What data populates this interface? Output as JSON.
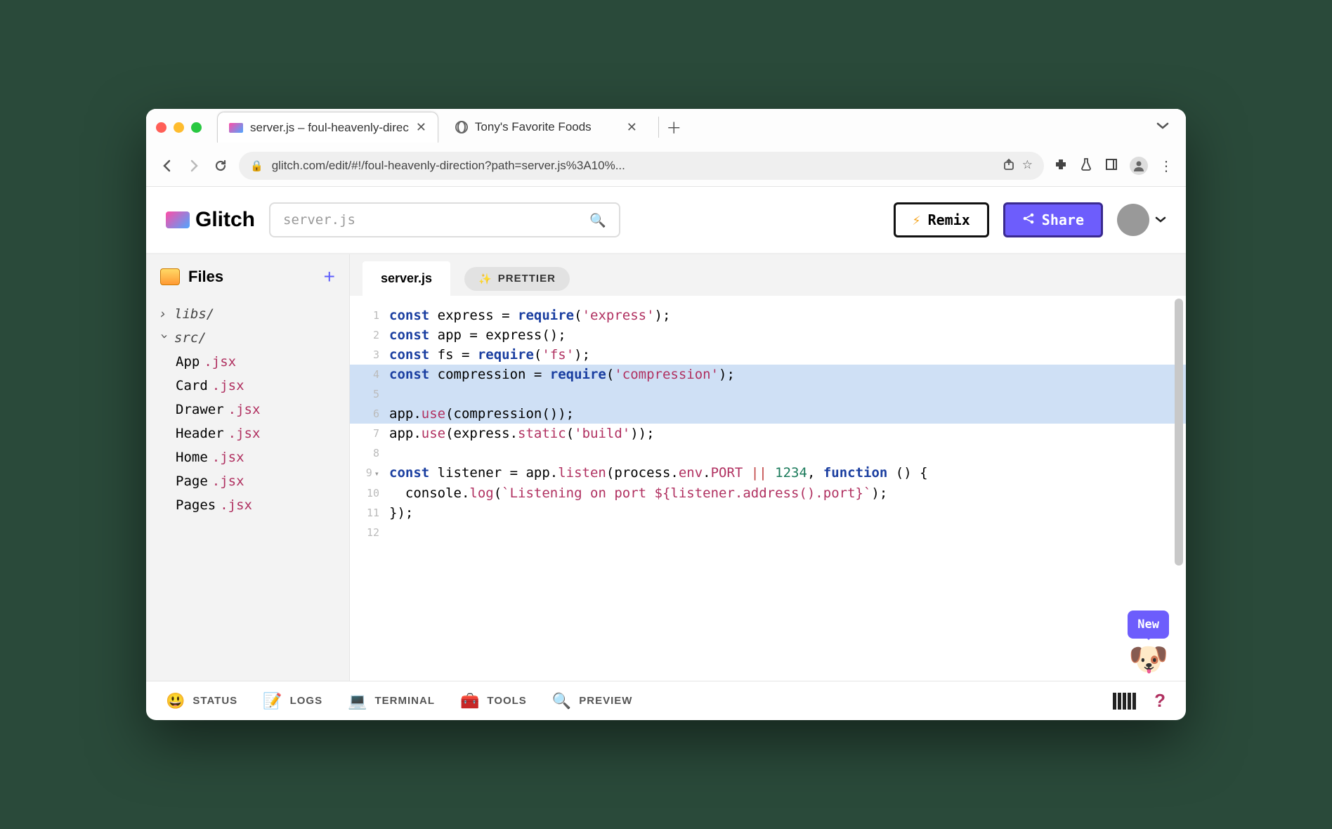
{
  "browser": {
    "tabs": [
      {
        "title": "server.js – foul-heavenly-direc",
        "active": true
      },
      {
        "title": "Tony's Favorite Foods",
        "active": false
      }
    ],
    "url": "glitch.com/edit/#!/foul-heavenly-direction?path=server.js%3A10%..."
  },
  "header": {
    "logo": "Glitch",
    "search_placeholder": "server.js",
    "remix": "Remix",
    "share": "Share"
  },
  "sidebar": {
    "title": "Files",
    "folders": [
      {
        "name": "libs/",
        "expanded": false
      },
      {
        "name": "src/",
        "expanded": true
      }
    ],
    "files": [
      {
        "base": "App",
        "ext": ".jsx"
      },
      {
        "base": "Card",
        "ext": ".jsx"
      },
      {
        "base": "Drawer",
        "ext": ".jsx"
      },
      {
        "base": "Header",
        "ext": ".jsx"
      },
      {
        "base": "Home",
        "ext": ".jsx"
      },
      {
        "base": "Page",
        "ext": ".jsx"
      },
      {
        "base": "Pages",
        "ext": ".jsx"
      }
    ]
  },
  "editor": {
    "filename": "server.js",
    "prettier": "PRETTIER"
  },
  "mascot": {
    "bubble": "New"
  },
  "footer": {
    "status": "STATUS",
    "logs": "LOGS",
    "terminal": "TERMINAL",
    "tools": "TOOLS",
    "preview": "PREVIEW"
  },
  "code_lines": [
    "const express = require('express');",
    "const app = express();",
    "const fs = require('fs');",
    "const compression = require('compression');",
    "",
    "app.use(compression());",
    "app.use(express.static('build'));",
    "",
    "const listener = app.listen(process.env.PORT || 1234, function () {",
    "  console.log(`Listening on port ${listener.address().port}`);",
    "});",
    ""
  ],
  "highlighted_lines": [
    4,
    5,
    6
  ]
}
